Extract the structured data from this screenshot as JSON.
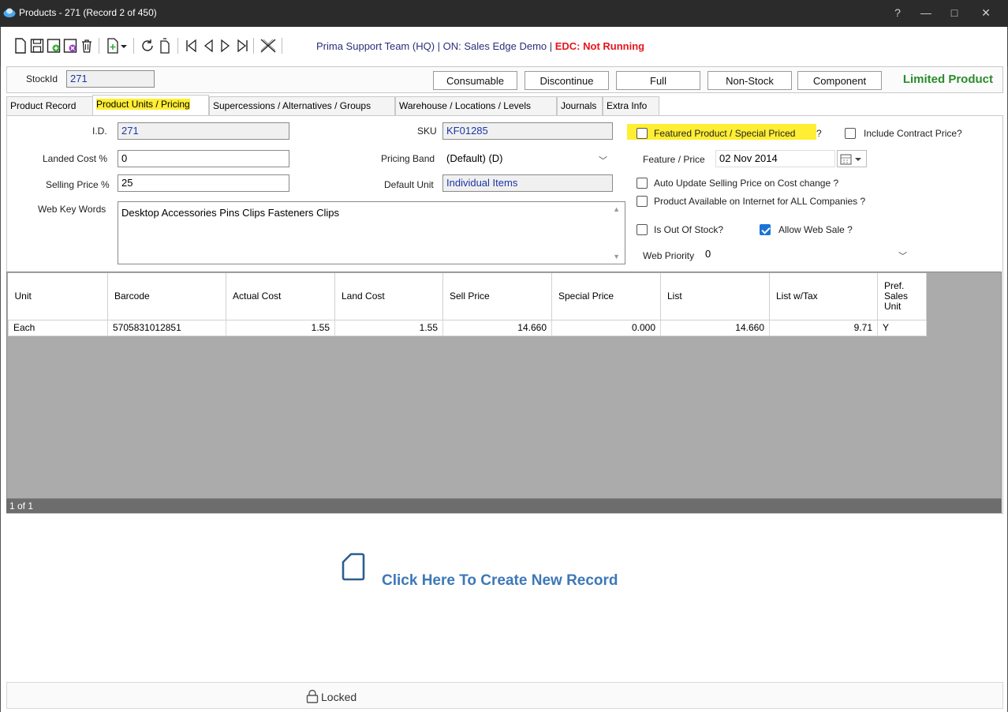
{
  "window": {
    "title": "Products - 271  (Record 2 of 450)",
    "controls": {
      "help": "?",
      "minimize": "—",
      "maximize": "□",
      "close": "✕"
    }
  },
  "toolbar": {
    "context_prefix": "Prima Support Team  (HQ) | ON: Sales Edge Demo | ",
    "edc_status": "EDC: Not Running",
    "icons": [
      "new-icon",
      "save-icon",
      "save-new-icon",
      "save-close-icon",
      "delete-icon",
      "add-dropdown-icon",
      "refresh-icon",
      "copy-icon",
      "first-record-icon",
      "previous-record-icon",
      "next-record-icon",
      "last-record-icon",
      "close-form-icon"
    ]
  },
  "header": {
    "stockid_label": "StockId",
    "stockid_value": "271",
    "buttons": [
      "Consumable",
      "Discontinue",
      "Full",
      "Non-Stock",
      "Component"
    ],
    "status_text": "Limited Product"
  },
  "tabs": [
    {
      "label": "Product Record",
      "active": false
    },
    {
      "label": "Product Units / Pricing",
      "active": true
    },
    {
      "label": "Supercessions / Alternatives / Groups",
      "active": false
    },
    {
      "label": "Warehouse / Locations / Levels",
      "active": false
    },
    {
      "label": "Journals",
      "active": false
    },
    {
      "label": "Extra Info",
      "active": false
    }
  ],
  "form": {
    "id_label": "I.D.",
    "id_value": "271",
    "landed_label": "Landed Cost %",
    "landed_value": "0",
    "selling_label": "Selling Price %",
    "selling_value": "25",
    "webkey_label": "Web Key Words",
    "webkey_value": "Desktop Accessories Pins Clips Fasteners Clips",
    "sku_label": "SKU",
    "sku_value": "KF01285",
    "band_label": "Pricing Band",
    "band_value": "(Default)   (D)",
    "unit_label": "Default Unit",
    "unit_value": "Individual Items",
    "featured_label": "Featured Product / Special Priced",
    "featured_suffix": "?",
    "featured_checked": false,
    "contract_label": "Include Contract Price?",
    "contract_checked": false,
    "feature_price_label": "Feature / Price",
    "feature_price_date": "02 Nov 2014",
    "auto_update_label": "Auto Update Selling Price on Cost change ?",
    "auto_update_checked": false,
    "internet_label": "Product Available on Internet for ALL Companies ?",
    "internet_checked": false,
    "out_of_stock_label": "Is Out Of Stock?",
    "out_of_stock_checked": false,
    "web_sale_label": "Allow Web Sale ?",
    "web_sale_checked": true,
    "web_priority_label": "Web Priority",
    "web_priority_value": "0"
  },
  "grid": {
    "columns": [
      "Unit",
      "Barcode",
      "Actual Cost",
      "Land Cost",
      "Sell Price",
      "Special Price",
      "List",
      "List w/Tax",
      "Pref. Sales Unit"
    ],
    "rows": [
      [
        "Each",
        "5705831012851",
        "1.55",
        "1.55",
        "14.660",
        "0.000",
        "14.660",
        "9.71",
        "Y"
      ]
    ],
    "pager": "1 of 1"
  },
  "create": {
    "label": "Click Here To Create New Record"
  },
  "footer": {
    "lock_label": "Locked"
  },
  "colors": {
    "edc": "#e8141c",
    "limited": "#2a8c2a",
    "highlight": "#ffee33",
    "create_link": "#3d78b8",
    "checkbox_on": "#1a73d9"
  }
}
